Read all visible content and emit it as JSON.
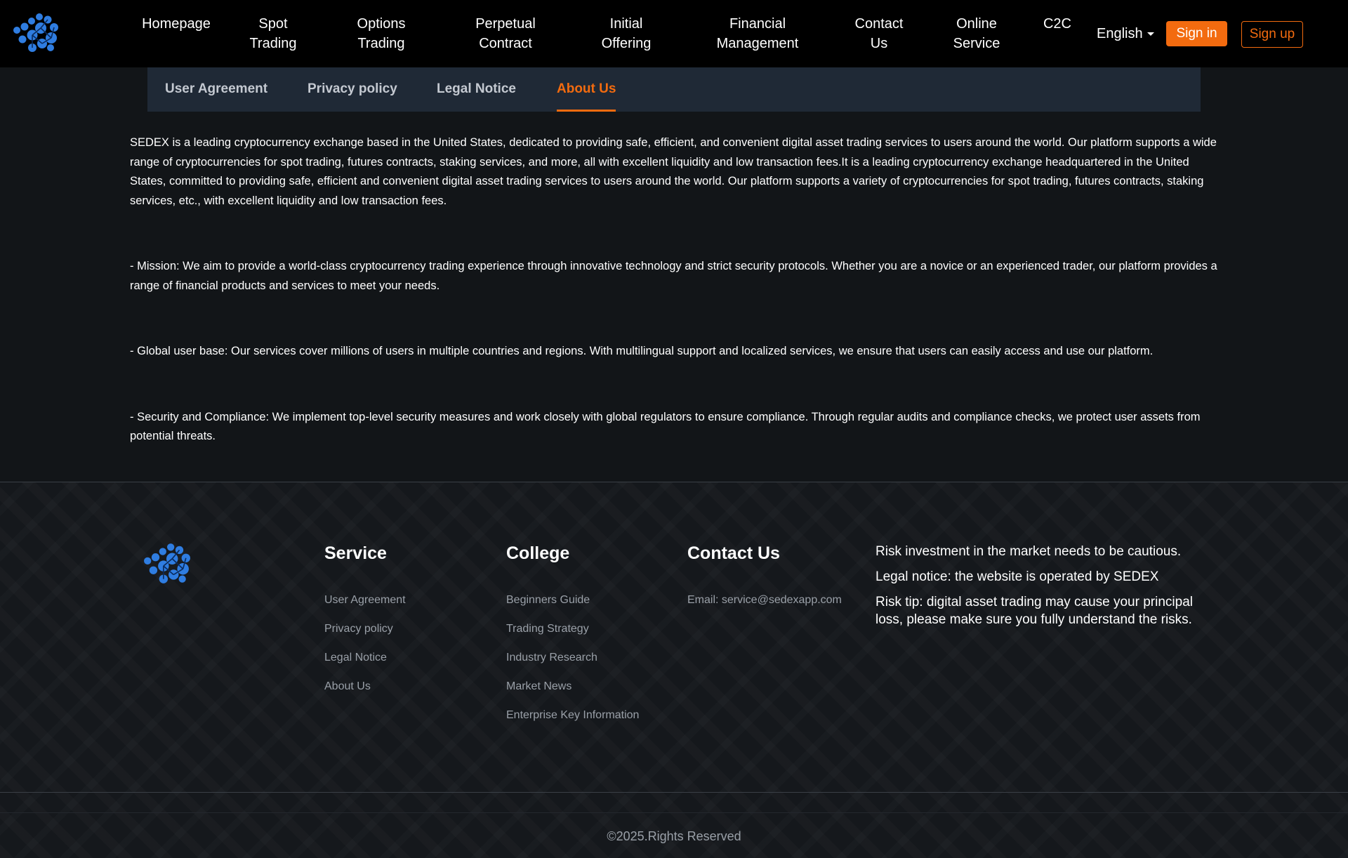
{
  "header": {
    "nav": [
      {
        "key": "homepage",
        "label": "Homepage"
      },
      {
        "key": "spot-trading",
        "label": "Spot\nTrading"
      },
      {
        "key": "options-trading",
        "label": "Options\nTrading"
      },
      {
        "key": "perpetual-contract",
        "label": "Perpetual\nContract"
      },
      {
        "key": "initial-offering",
        "label": "Initial\nOffering"
      },
      {
        "key": "financial-management",
        "label": "Financial\nManagement"
      },
      {
        "key": "contact-us",
        "label": "Contact\nUs"
      },
      {
        "key": "online-service",
        "label": "Online\nService"
      },
      {
        "key": "c2c",
        "label": "C2C"
      }
    ],
    "language": "English",
    "sign_in": "Sign in",
    "sign_up": "Sign up"
  },
  "tabs": {
    "items": [
      "User Agreement",
      "Privacy policy",
      "Legal Notice",
      "About Us"
    ],
    "active": "About Us"
  },
  "content": {
    "paragraphs": [
      "SEDEX is a leading cryptocurrency exchange based in the United States, dedicated to providing safe, efficient, and convenient digital asset trading services to users around the world. Our platform supports a wide range of cryptocurrencies for spot trading, futures contracts, staking services, and more, all with excellent liquidity and low transaction fees.It is a leading cryptocurrency exchange headquartered in the United States, committed to providing safe, efficient and convenient digital asset trading services to users around the world. Our platform supports a variety of cryptocurrencies for spot trading, futures contracts, staking services, etc., with excellent liquidity and low transaction fees.",
      "- Mission: We aim to provide a world-class cryptocurrency trading experience through innovative technology and strict security protocols. Whether you are a novice or an experienced trader, our platform provides a range of financial products and services to meet your needs.",
      "- Global user base: Our services cover millions of users in multiple countries and regions. With multilingual support and localized services, we ensure that users can easily access and use our platform.",
      "- Security and Compliance: We implement top-level security measures and work closely with global regulators to ensure compliance. Through regular audits and compliance checks, we protect user assets from potential threats."
    ]
  },
  "footer": {
    "service": {
      "title": "Service",
      "links": [
        "User Agreement",
        "Privacy policy",
        "Legal Notice",
        "About Us"
      ]
    },
    "college": {
      "title": "College",
      "links": [
        "Beginners Guide",
        "Trading Strategy",
        "Industry Research",
        "Market News",
        "Enterprise Key Information"
      ]
    },
    "contact": {
      "title": "Contact Us",
      "email": "Email: service@sedexapp.com"
    },
    "risk": [
      "Risk investment in the market needs to be cautious.",
      "Legal notice: the website is operated by SEDEX",
      "Risk tip: digital asset trading may cause your principal loss, please make sure you fully understand the risks."
    ],
    "copyright": "©2025.Rights Reserved"
  },
  "colors": {
    "accent": "#f36b0f",
    "logo_blue": "#2f7de1",
    "header_bg": "#000000",
    "tab_bar_bg": "#1f2936",
    "page_bg": "#121518"
  },
  "icons": {
    "logo": "sedex-logo-icon",
    "language_caret": "caret-down-icon"
  }
}
